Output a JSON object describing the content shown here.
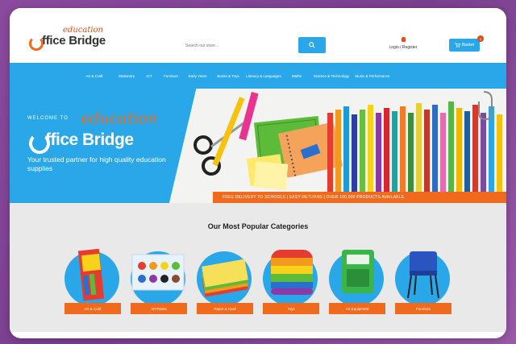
{
  "header": {
    "logo_text": "ffice Bridge",
    "logo_script": "education",
    "search_placeholder": "Search our store...",
    "search_button_icon": "search-icon",
    "account_label": "Login / Register",
    "basket_label": "Basket",
    "basket_count": "0"
  },
  "nav": {
    "items": [
      "Art & Craft",
      "Stationery",
      "ICT",
      "Furniture",
      "Early Years",
      "Books & Toys",
      "Literacy & Languages",
      "Maths",
      "Science & Technology",
      "Music & Performance"
    ]
  },
  "hero": {
    "welcome": "WELCOME TO",
    "script": "education",
    "logo_text": "ffice Bridge",
    "tagline": "Your trusted partner for high quality education supplies",
    "strip": "FREE DELIVERY TO SCHOOLS  |  EASY RETURNS  |  OVER 100,000 PRODUCTS AVAILABLE"
  },
  "categories": {
    "title": "Our Most Popular Categories",
    "items": [
      {
        "label": "Art & Craft"
      },
      {
        "label": "Art Paints"
      },
      {
        "label": "Paper & Card"
      },
      {
        "label": "Toys"
      },
      {
        "label": "Art Equipment"
      },
      {
        "label": "Furniture"
      }
    ]
  },
  "colors": {
    "brand_blue": "#2aa7e8",
    "brand_orange": "#f06a1e"
  }
}
